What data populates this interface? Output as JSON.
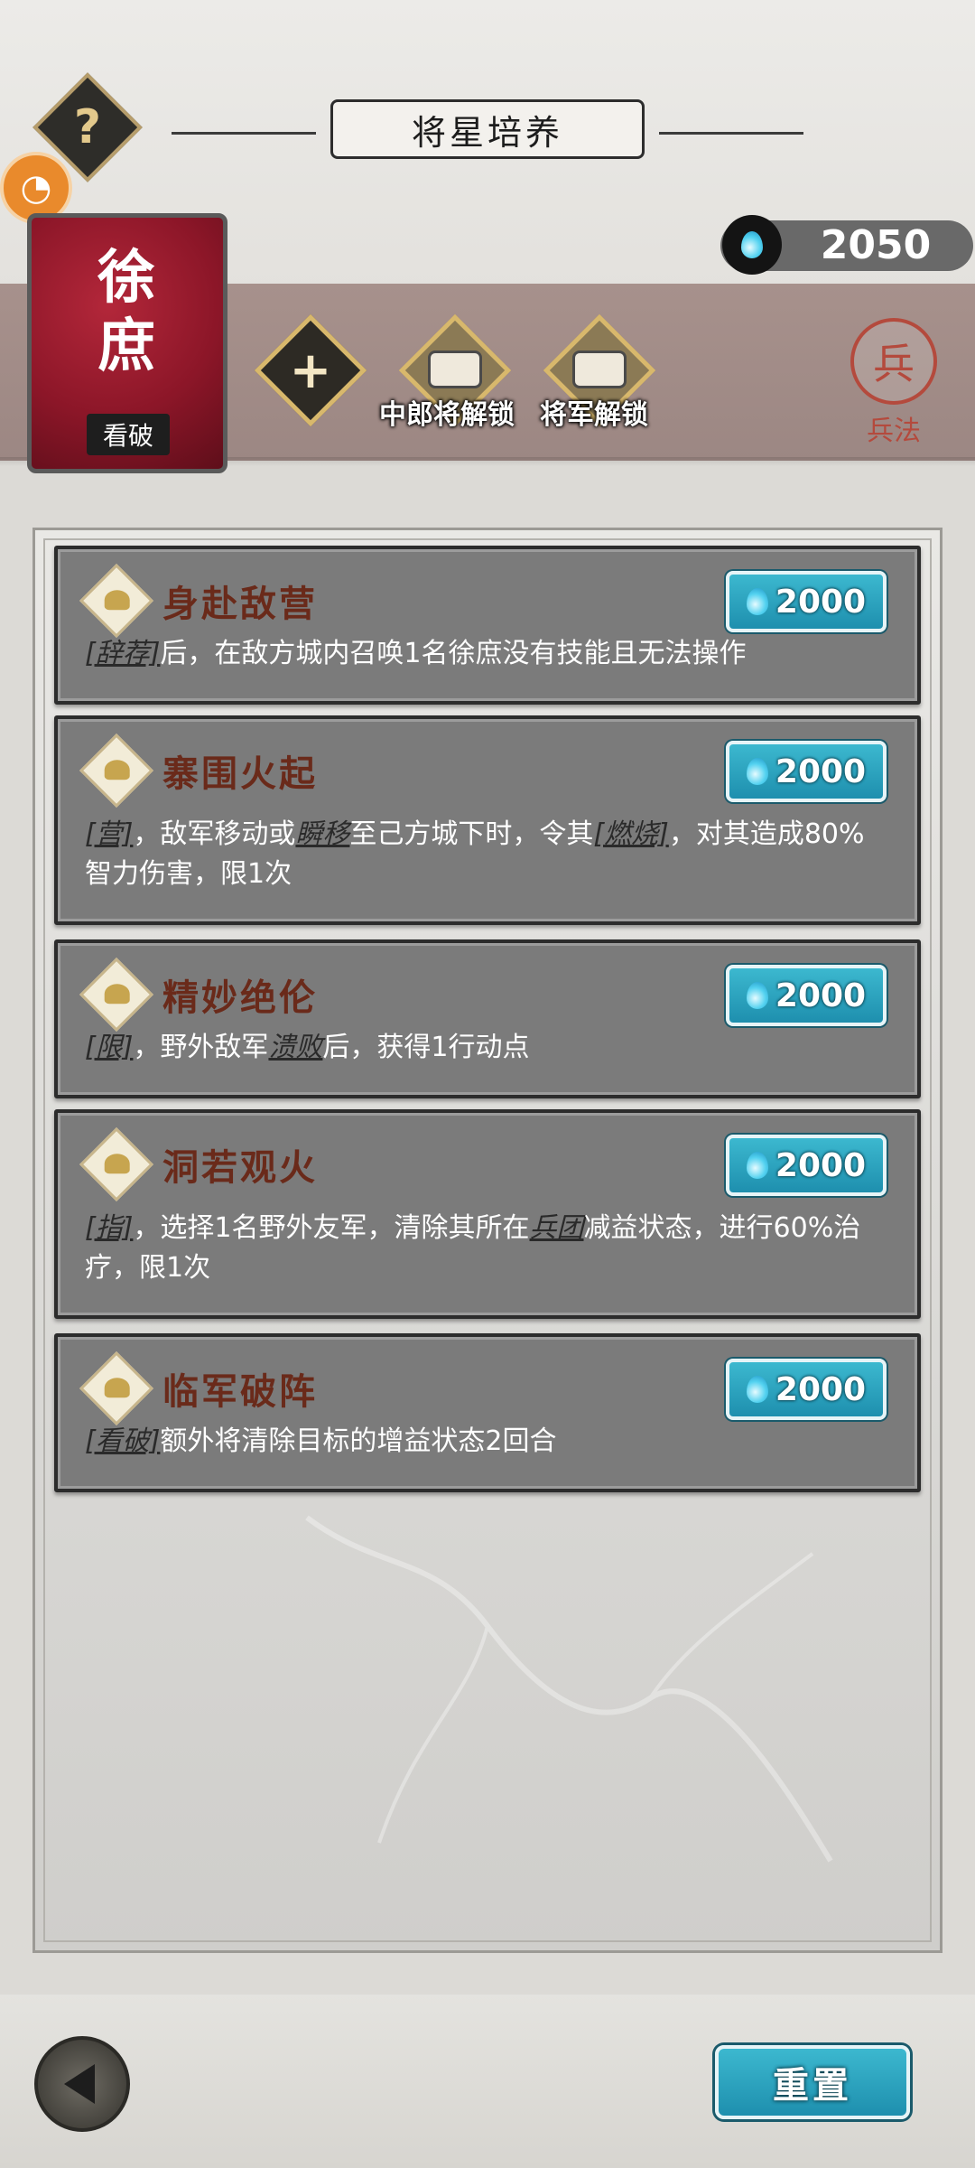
{
  "header": {
    "title": "将星培养"
  },
  "currency": {
    "value": "2050",
    "icon": "blue-flame-icon",
    "color": "#53d2f0"
  },
  "hero": {
    "name": "徐庶",
    "tag": "看破"
  },
  "slots": [
    {
      "type": "add",
      "label": ""
    },
    {
      "type": "locked",
      "label": "中郎将解锁"
    },
    {
      "type": "locked",
      "label": "将军解锁"
    }
  ],
  "bingfa": {
    "glyph": "兵",
    "label": "兵法"
  },
  "skills": [
    {
      "title": "身赴敌营",
      "cost": "2000",
      "desc": [
        [
          "key",
          "[辞荐]"
        ],
        [
          "text",
          "后，在敌方城内召唤1名徐庶没有技能且无法操作"
        ]
      ]
    },
    {
      "title": "寨围火起",
      "cost": "2000",
      "desc": [
        [
          "key",
          "[营]"
        ],
        [
          "text",
          "，敌军移动或"
        ],
        [
          "key",
          "瞬移"
        ],
        [
          "text",
          "至己方城下时，令其"
        ],
        [
          "key",
          "[燃烧]"
        ],
        [
          "text",
          "，对其造成80%智力伤害，限1次"
        ]
      ]
    },
    {
      "title": "精妙绝伦",
      "cost": "2000",
      "desc": [
        [
          "key",
          "[限]"
        ],
        [
          "text",
          "，野外敌军"
        ],
        [
          "key",
          "溃败"
        ],
        [
          "text",
          "后，获得1行动点"
        ]
      ]
    },
    {
      "title": "洞若观火",
      "cost": "2000",
      "desc": [
        [
          "key",
          "[指]"
        ],
        [
          "text",
          "，选择1名野外友军，清除其所在"
        ],
        [
          "key",
          "兵团"
        ],
        [
          "text",
          "减益状态，进行60%治疗，限1次"
        ]
      ]
    },
    {
      "title": "临军破阵",
      "cost": "2000",
      "desc": [
        [
          "key",
          "[看破]"
        ],
        [
          "text",
          "额外将清除目标的增益状态2回合"
        ]
      ]
    }
  ],
  "footer": {
    "reset_label": "重置"
  }
}
